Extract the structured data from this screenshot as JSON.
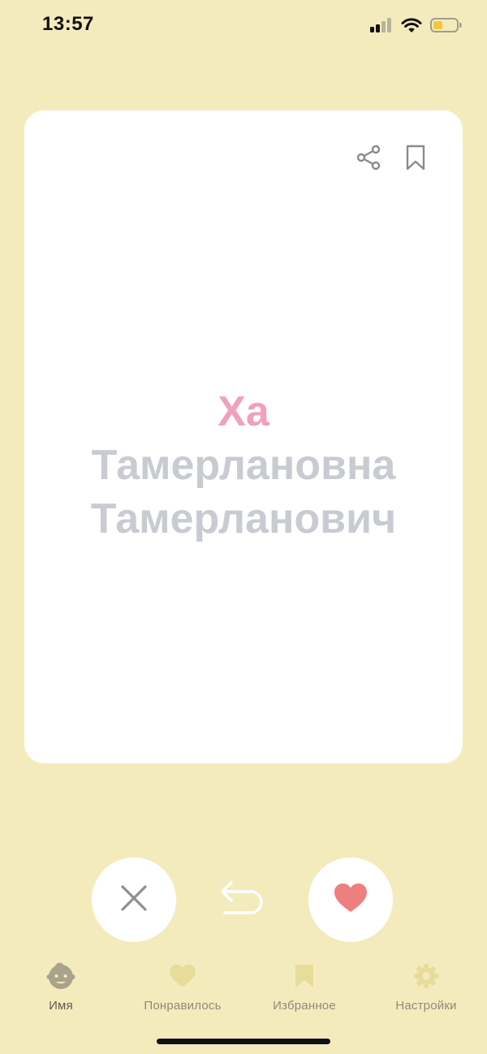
{
  "status_bar": {
    "time": "13:57"
  },
  "card": {
    "first_name": "Ха",
    "patronymic_female": "Тамерлановна",
    "patronymic_male": "Тамерланович",
    "icons": [
      "share-icon",
      "bookmark-icon"
    ]
  },
  "actions": {
    "dislike_icon": "close-icon",
    "undo_icon": "undo-arrow-icon",
    "like_icon": "heart-icon"
  },
  "tabs": [
    {
      "label": "Имя",
      "icon": "baby-face-icon",
      "active": true
    },
    {
      "label": "Понравилось",
      "icon": "heart-icon",
      "active": false
    },
    {
      "label": "Избранное",
      "icon": "bookmark-icon",
      "active": false
    },
    {
      "label": "Настройки",
      "icon": "gear-icon",
      "active": false
    }
  ],
  "colors": {
    "background": "#f4ebbd",
    "first_name": "#f0a1bb",
    "patronymic": "#c8cbd1",
    "like": "#ef7f7f",
    "tab_icon": "#e8dc9a"
  }
}
